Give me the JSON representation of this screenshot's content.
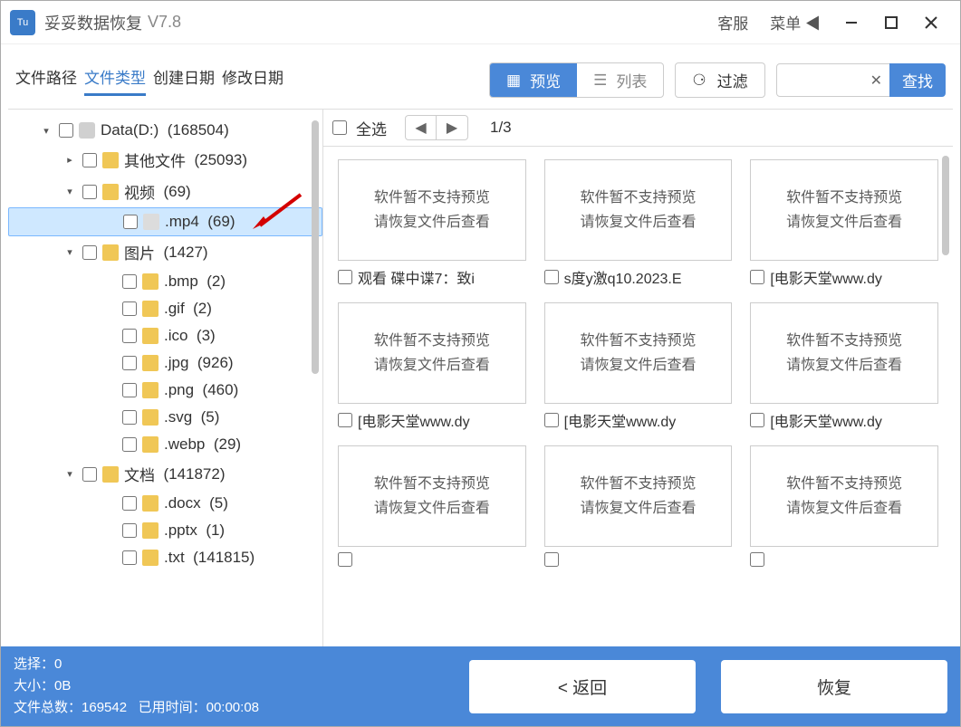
{
  "titlebar": {
    "logo_text": "Tu",
    "title": "妥妥数据恢复",
    "version": "V7.8",
    "support": "客服",
    "menu": "菜单"
  },
  "tabs": {
    "path": "文件路径",
    "type": "文件类型",
    "created": "创建日期",
    "modified": "修改日期"
  },
  "viewmode": {
    "preview": "预览",
    "list": "列表"
  },
  "filter_label": "过滤",
  "search": {
    "value": "",
    "btn": "查找"
  },
  "preview": {
    "select_all": "全选",
    "page": "1/3",
    "unsupported_line1": "软件暂不支持预览",
    "unsupported_line2": "请恢复文件后查看",
    "files": [
      "观看 碟中谍7：致i",
      "s度y激q10.2023.E",
      "[电影天堂www.dy",
      "[电影天堂www.dy",
      "[电影天堂www.dy",
      "[电影天堂www.dy",
      "",
      "",
      ""
    ]
  },
  "tree": {
    "root_label": "Data(D:)",
    "root_count": "(168504)",
    "other_label": "其他文件",
    "other_count": "(25093)",
    "video_label": "视频",
    "video_count": "(69)",
    "mp4_label": ".mp4",
    "mp4_count": "(69)",
    "image_label": "图片",
    "image_count": "(1427)",
    "bmp_label": ".bmp",
    "bmp_count": "(2)",
    "gif_label": ".gif",
    "gif_count": "(2)",
    "ico_label": ".ico",
    "ico_count": "(3)",
    "jpg_label": ".jpg",
    "jpg_count": "(926)",
    "png_label": ".png",
    "png_count": "(460)",
    "svg_label": ".svg",
    "svg_count": "(5)",
    "webp_label": ".webp",
    "webp_count": "(29)",
    "doc_label": "文档",
    "doc_count": "(141872)",
    "docx_label": ".docx",
    "docx_count": "(5)",
    "pptx_label": ".pptx",
    "pptx_count": "(1)",
    "txt_label": ".txt",
    "txt_count": "(141815)"
  },
  "status": {
    "selected_label": "选择：",
    "selected_val": "0",
    "size_label": "大小：",
    "size_val": "0B",
    "total_label": "文件总数：",
    "total_val": "169542",
    "elapsed_label": "已用时间：",
    "elapsed_val": "00:00:08",
    "back": "< 返回",
    "recover": "恢复"
  }
}
